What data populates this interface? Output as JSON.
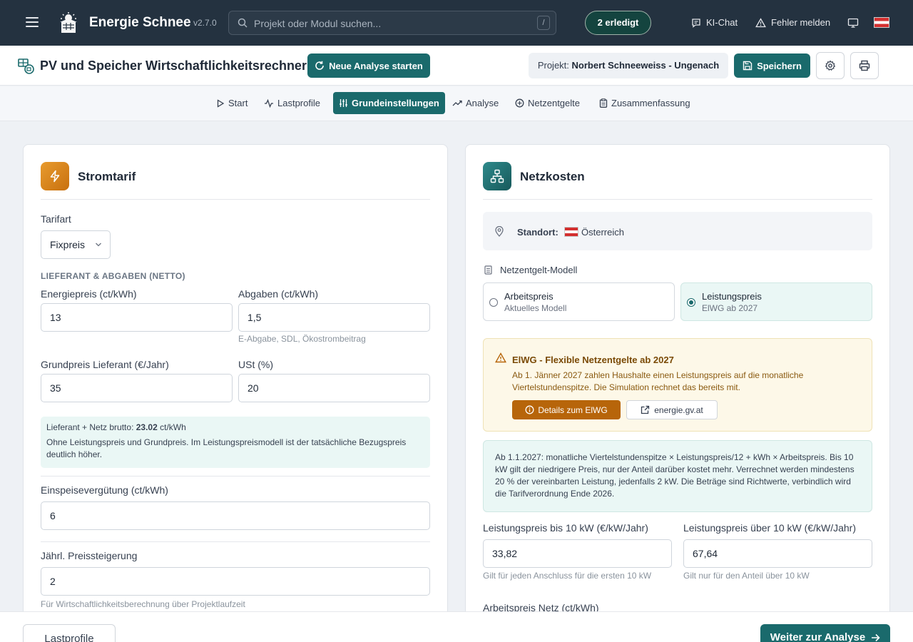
{
  "app": {
    "name": "Energie Schnee",
    "version": "v2.7.0",
    "search_placeholder": "Projekt oder Modul suchen...",
    "search_shortcut": "/",
    "done_badge": "2 erledigt",
    "ai_chat": "KI-Chat",
    "report_error": "Fehler melden"
  },
  "header": {
    "title": "PV und Speicher Wirtschaftlichkeitsrechner",
    "new_analysis": "Neue Analyse starten",
    "project_label": "Projekt:",
    "project_name": "Norbert Schneeweiss - Ungenach",
    "save": "Speichern"
  },
  "tabs": [
    {
      "label": "Start",
      "active": false
    },
    {
      "label": "Lastprofile",
      "active": false
    },
    {
      "label": "Grundeinstellungen",
      "active": true
    },
    {
      "label": "Analyse",
      "active": false
    },
    {
      "label": "Netzentgelte",
      "active": false
    },
    {
      "label": "Zusammenfassung",
      "active": false
    }
  ],
  "stromtarif": {
    "title": "Stromtarif",
    "tarifart_label": "Tarifart",
    "tarifart_value": "Fixpreis",
    "section_caption": "LIEFERANT & ABGABEN (NETTO)",
    "energiepreis_label": "Energiepreis (ct/kWh)",
    "energiepreis_value": "13",
    "abgaben_label": "Abgaben (ct/kWh)",
    "abgaben_value": "1,5",
    "abgaben_hint": "E-Abgabe, SDL, Ökostrombeitrag",
    "grundpreis_label": "Grundpreis Lieferant (€/Jahr)",
    "grundpreis_value": "35",
    "ust_label": "USt (%)",
    "ust_value": "20",
    "brutto_prefix": "Lieferant + Netz brutto:",
    "brutto_value": "23.02",
    "brutto_unit": "ct/kWh",
    "brutto_note": "Ohne Leistungspreis und Grundpreis. Im Leistungspreismodell ist der tatsächliche Bezugspreis deutlich höher.",
    "einspeise_label": "Einspeisevergütung (ct/kWh)",
    "einspeise_value": "6",
    "steigerung_label": "Jährl. Preissteigerung",
    "steigerung_value": "2",
    "steigerung_hint": "Für Wirtschaftlichkeitsberechnung über Projektlaufzeit"
  },
  "netzkosten": {
    "title": "Netzkosten",
    "standort_label": "Standort:",
    "standort_value": "Österreich",
    "modell_label": "Netzentgelt-Modell",
    "option_arbeitspreis_title": "Arbeitspreis",
    "option_arbeitspreis_sub": "Aktuelles Modell",
    "option_leistungspreis_title": "Leistungspreis",
    "option_leistungspreis_sub": "ElWG ab 2027",
    "selected_option": "Leistungspreis",
    "warn_title": "ElWG - Flexible Netzentgelte ab 2027",
    "warn_text": "Ab 1. Jänner 2027 zahlen Haushalte einen Leistungspreis auf die monatliche Viertelstundenspitze. Die Simulation rechnet das bereits mit.",
    "warn_button": "Details zum ElWG",
    "warn_link": "energie.gv.at",
    "formula_text": "Ab 1.1.2027: monatliche Viertelstundenspitze × Leistungspreis/12 + kWh × Arbeitspreis. Bis 10 kW gilt der niedrigere Preis, nur der Anteil darüber kostet mehr. Verrechnet werden mindestens 20 % der vereinbarten Leistung, jedenfalls 2 kW. Die Beträge sind Richtwerte, verbindlich wird die Tarifverordnung Ende 2026.",
    "lp_bis10_label": "Leistungspreis bis 10 kW (€/kW/Jahr)",
    "lp_bis10_value": "33,82",
    "lp_bis10_hint": "Gilt für jeden Anschluss für die ersten 10 kW",
    "lp_ueber10_label": "Leistungspreis über 10 kW (€/kW/Jahr)",
    "lp_ueber10_value": "67,64",
    "lp_ueber10_hint": "Gilt nur für den Anteil über 10 kW",
    "arbeitspreis_netz_label": "Arbeitspreis Netz (ct/kWh)"
  },
  "footer": {
    "back": "Lastprofile",
    "next": "Weiter zur Analyse"
  },
  "colors": {
    "topbar": "#243240",
    "accent": "#1a6a6c",
    "amber": "#b7650a"
  }
}
